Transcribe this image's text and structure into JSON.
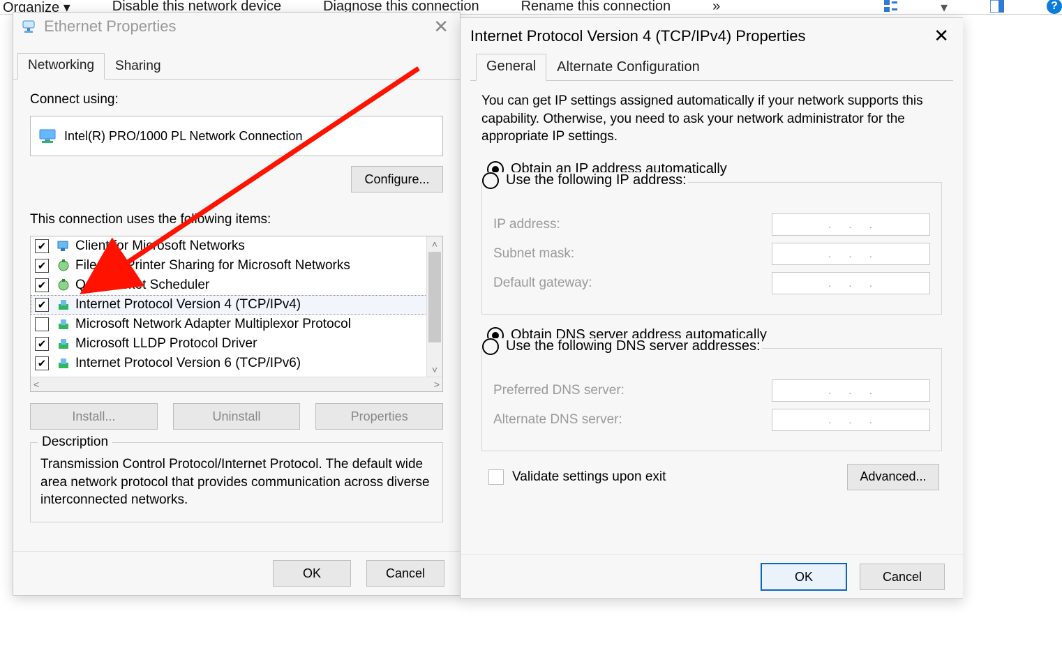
{
  "toolbar": {
    "organize": "Organize ▾",
    "disable": "Disable this network device",
    "diagnose": "Diagnose this connection",
    "rename": "Rename this connection",
    "overflow": "»"
  },
  "eth": {
    "title": "Ethernet Properties",
    "tabs": {
      "networking": "Networking",
      "sharing": "Sharing"
    },
    "connect_using": "Connect using:",
    "adapter": "Intel(R) PRO/1000 PL Network Connection",
    "configure": "Configure...",
    "items_label": "This connection uses the following items:",
    "items": [
      {
        "checked": true,
        "label": "Client for Microsoft Networks"
      },
      {
        "checked": true,
        "label": "File and Printer Sharing for Microsoft Networks"
      },
      {
        "checked": true,
        "label": "QoS Packet Scheduler"
      },
      {
        "checked": true,
        "label": "Internet Protocol Version 4 (TCP/IPv4)",
        "selected": true
      },
      {
        "checked": false,
        "label": "Microsoft Network Adapter Multiplexor Protocol"
      },
      {
        "checked": true,
        "label": "Microsoft LLDP Protocol Driver"
      },
      {
        "checked": true,
        "label": "Internet Protocol Version 6 (TCP/IPv6)"
      }
    ],
    "install": "Install...",
    "uninstall": "Uninstall",
    "properties": "Properties",
    "desc_legend": "Description",
    "desc_text": "Transmission Control Protocol/Internet Protocol. The default wide area network protocol that provides communication across diverse interconnected networks.",
    "ok": "OK",
    "cancel": "Cancel"
  },
  "ip": {
    "title": "Internet Protocol Version 4 (TCP/IPv4) Properties",
    "tabs": {
      "general": "General",
      "alt": "Alternate Configuration"
    },
    "intro": "You can get IP settings assigned automatically if your network supports this capability. Otherwise, you need to ask your network administrator for the appropriate IP settings.",
    "obtain_ip": "Obtain an IP address automatically",
    "use_ip": "Use the following IP address:",
    "ip_address": "IP address:",
    "subnet": "Subnet mask:",
    "gateway": "Default gateway:",
    "obtain_dns": "Obtain DNS server address automatically",
    "use_dns": "Use the following DNS server addresses:",
    "pref_dns": "Preferred DNS server:",
    "alt_dns": "Alternate DNS server:",
    "validate": "Validate settings upon exit",
    "advanced": "Advanced...",
    "ok": "OK",
    "cancel": "Cancel"
  }
}
